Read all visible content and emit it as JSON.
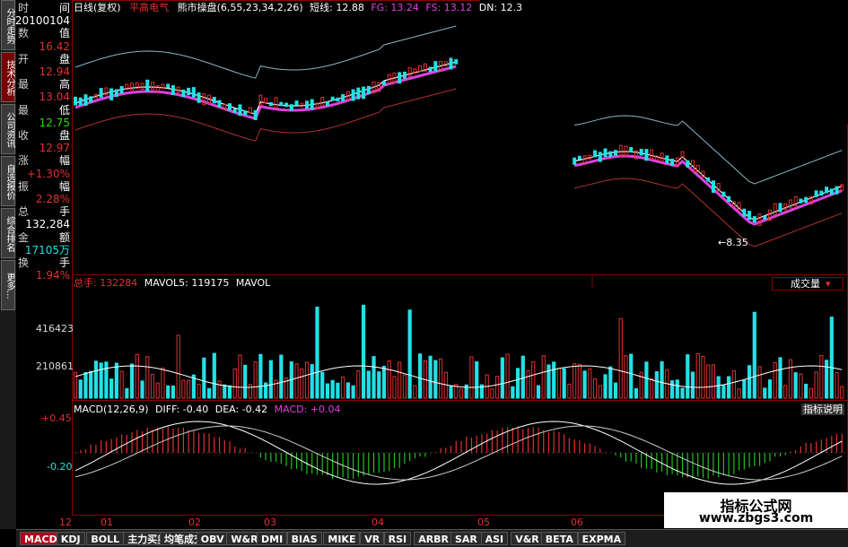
{
  "left_tabs": [
    "分时走势",
    "技术分析",
    "公司资讯",
    "自选报价",
    "综合排名",
    "更多..."
  ],
  "info": {
    "rows": [
      {
        "label": "时",
        "right": "间"
      },
      {
        "label": "",
        "right": "20100104"
      },
      {
        "label": "数",
        "right": "值"
      },
      {
        "label": "",
        "right": "16.42"
      },
      {
        "label": "开",
        "right": "盘"
      },
      {
        "label": "",
        "right": "12.94"
      },
      {
        "label": "最",
        "right": "高"
      },
      {
        "label": "",
        "right": "13.04"
      },
      {
        "label": "最",
        "right": "低"
      },
      {
        "label": "",
        "right": "12.75"
      },
      {
        "label": "收",
        "right": "盘"
      },
      {
        "label": "",
        "right": "12.97"
      },
      {
        "label": "涨",
        "right": "幅"
      },
      {
        "label": "",
        "right": "+1.30%"
      },
      {
        "label": "振",
        "right": "幅"
      },
      {
        "label": "",
        "right": "2.28%"
      },
      {
        "label": "总",
        "right": "手"
      },
      {
        "label": "",
        "right": "132,284"
      },
      {
        "label": "金",
        "right": "额"
      },
      {
        "label": "",
        "right": "17105万"
      },
      {
        "label": "换",
        "right": "手"
      },
      {
        "label": "",
        "right": "1.94%"
      }
    ]
  },
  "price_header": {
    "period": "日线(复权)",
    "stock": "平高电气",
    "indicator": "熊市操盘(6,55,23,34,2,26)",
    "short_label": "短线: 12.88",
    "fg": "FG: 13.24",
    "fs": "FS: 13.12",
    "dn": "DN: 12.3"
  },
  "price_annotation": "←8.35",
  "volume_header": {
    "total": "总手: 132284",
    "mavol5": "MAVOL5: 119175",
    "mavol": "MAVOL",
    "label": "成交量"
  },
  "volume_axis": [
    "416423",
    "210861"
  ],
  "macd_header": {
    "params": "MACD(12,26,9)",
    "diff": "DIFF: -0.40",
    "dea": "DEA: -0.42",
    "macd": "MACD: +0.04",
    "explain": "指标说明"
  },
  "macd_axis": [
    "+0.45",
    "-0.20"
  ],
  "x_axis": [
    "12",
    "01",
    "02",
    "03",
    "04",
    "05",
    "06"
  ],
  "bottom_tabs": [
    "MACD",
    "KDJ",
    "BOLL",
    "主力买卖",
    "均笔成交",
    "OBV",
    "W&R",
    "DMI",
    "BIAS",
    "MIKE",
    "VR",
    "RSI",
    "ARBR",
    "SAR",
    "ASI",
    "V&R",
    "BETA",
    "EXPMA"
  ],
  "watermark": {
    "line1": "指标公式网",
    "line2": "www.zbgs3.com"
  },
  "colors": {
    "up": "#e03030",
    "down": "#22e0e6",
    "magenta": "#e040e0",
    "yellow": "#ffff00",
    "frame": "#8a0000"
  },
  "chart_data": {
    "type": "candlestick",
    "price_axis_shown": [
      "16.42",
      "12.94",
      "13.04",
      "12.75",
      "12.97"
    ],
    "macd_axis_labels": [
      0.45,
      -0.2
    ],
    "volume_axis_labels": [
      416423,
      210861
    ]
  }
}
